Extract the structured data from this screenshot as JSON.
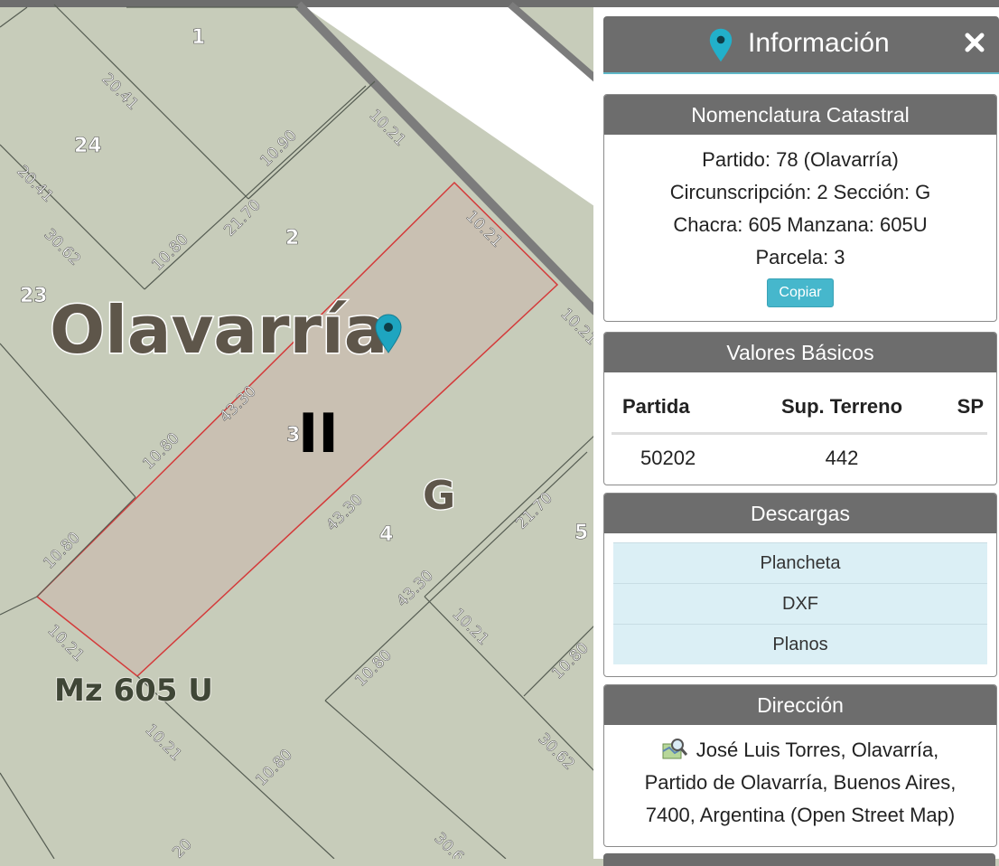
{
  "map": {
    "parcel_numbers": [
      "1",
      "24",
      "2",
      "23",
      "3",
      "4",
      "5"
    ],
    "lengths": [
      "20.41",
      "10.90",
      "10.21",
      "20.41",
      "21.70",
      "30.62",
      "10.80",
      "10.21",
      "10.21",
      "43.30",
      "10.80",
      "43.30",
      "21.70",
      "10.80",
      "43.30",
      "10.21",
      "10.80",
      "10.21",
      "10.80",
      "30.62",
      "10.21",
      "10.80",
      "30.6",
      "20"
    ],
    "city_label": "Olavarría",
    "circ_label": "II",
    "section_label": "G",
    "block_label": "Mz 605 U",
    "colors": {
      "ground": "#c7ccba",
      "selected_parcel": "#c9c0b2",
      "road": "#ffffff",
      "pin": "#1ea5c0",
      "dark_border": "#6d6d6d"
    }
  },
  "panel": {
    "title": "Información",
    "close_icon": "close-icon",
    "title_icon": "map-pin-icon",
    "nomenclatura": {
      "header": "Nomenclatura Catastral",
      "line1": "Partido: 78 (Olavarría)",
      "line2": "Circunscripción: 2 Sección: G",
      "line3": "Chacra: 605 Manzana: 605U",
      "line4": "Parcela: 3",
      "copy_label": "Copiar"
    },
    "valores": {
      "header": "Valores Básicos",
      "columns": [
        "Partida",
        "Sup. Terreno",
        "SP"
      ],
      "row": [
        "50202",
        "442",
        ""
      ]
    },
    "descargas": {
      "header": "Descargas",
      "items": [
        "Plancheta",
        "DXF",
        "Planos"
      ]
    },
    "direccion": {
      "header": "Dirección",
      "line1": "José Luis Torres, Olavarría,",
      "line2": "Partido de Olavarría, Buenos Aires,",
      "line3": "7400, Argentina (Open Street Map)",
      "icon": "map-search-icon"
    }
  }
}
